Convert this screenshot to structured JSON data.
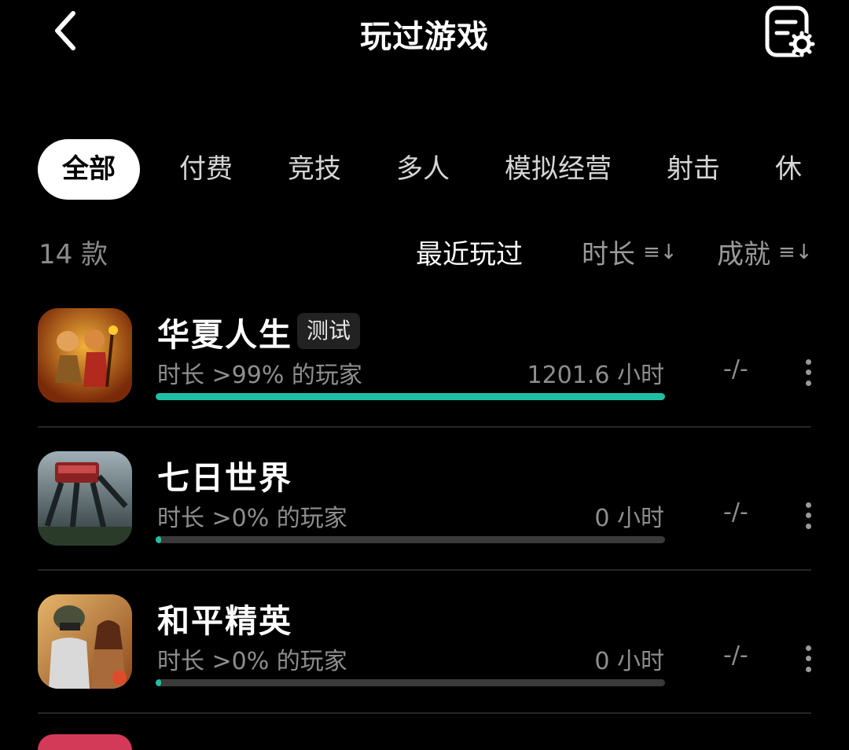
{
  "header": {
    "title": "玩过游戏"
  },
  "tabs": [
    "全部",
    "付费",
    "竞技",
    "多人",
    "模拟经营",
    "射击",
    "休"
  ],
  "summary": {
    "count": "14 款"
  },
  "sort": [
    {
      "label": "最近玩过",
      "active": true
    },
    {
      "label": "时长",
      "icon": "sort-icon"
    },
    {
      "label": "成就",
      "icon": "sort-icon"
    }
  ],
  "games": [
    {
      "name": "华夏人生",
      "badge": "测试",
      "percentile": "时长 >99% 的玩家",
      "hours": "1201.6 小时",
      "achievements": "-/-",
      "progress": 1.0
    },
    {
      "name": "七日世界",
      "percentile": "时长 >0% 的玩家",
      "hours": "0 小时",
      "achievements": "-/-",
      "progress": 0.0
    },
    {
      "name": "和平精英",
      "percentile": "时长 >0% 的玩家",
      "hours": "0 小时",
      "achievements": "-/-",
      "progress": 0.0
    }
  ],
  "colors": {
    "accent": "#1fbfa6",
    "background": "#000000"
  }
}
